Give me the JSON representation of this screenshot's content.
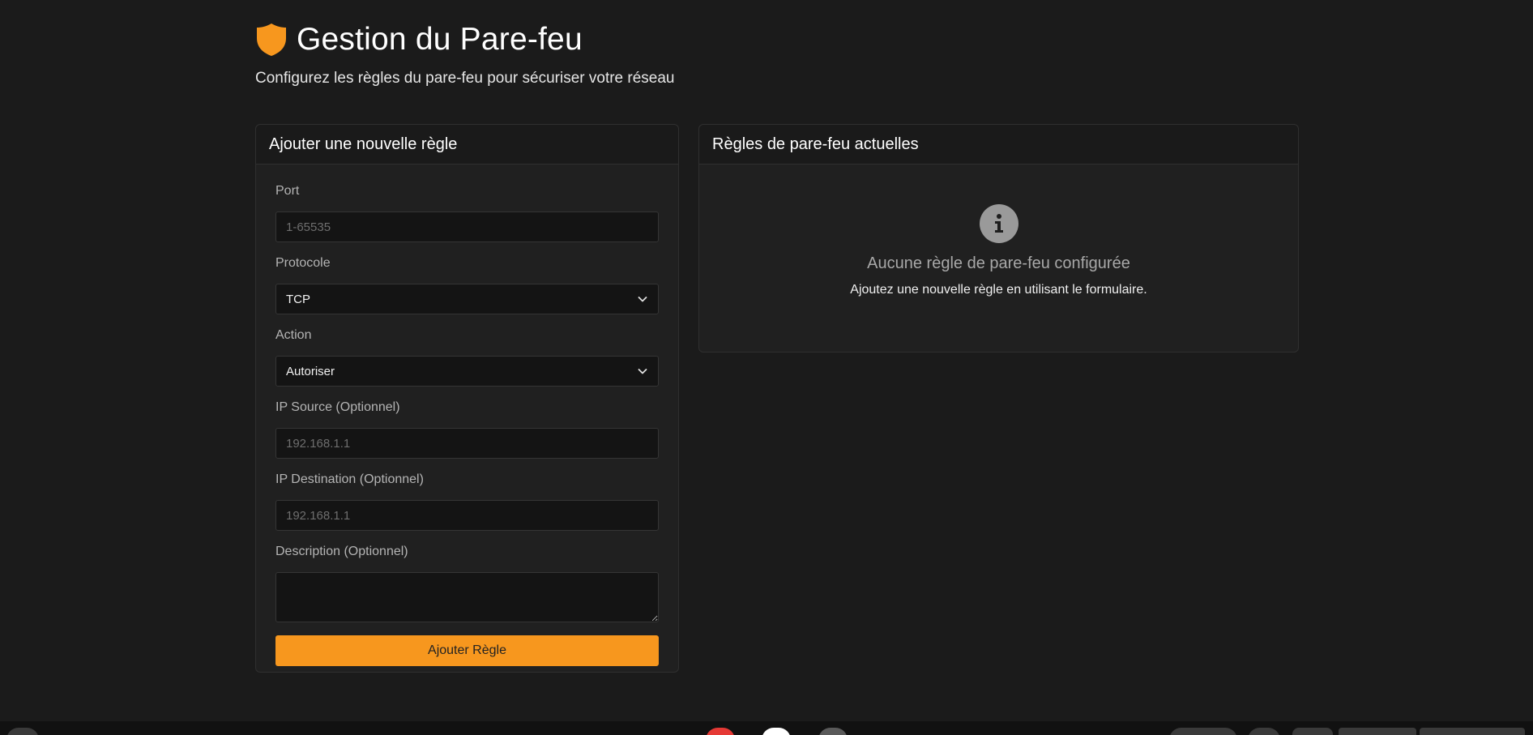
{
  "header": {
    "title": "Gestion du Pare-feu",
    "subtitle": "Configurez les règles du pare-feu pour sécuriser votre réseau"
  },
  "form": {
    "title": "Ajouter une nouvelle règle",
    "port": {
      "label": "Port",
      "value": "",
      "placeholder": "1-65535"
    },
    "protocol": {
      "label": "Protocole",
      "selected": "TCP"
    },
    "action": {
      "label": "Action",
      "selected": "Autoriser"
    },
    "source_ip": {
      "label": "IP Source (Optionnel)",
      "value": "",
      "placeholder": "192.168.1.1"
    },
    "destination_ip": {
      "label": "IP Destination (Optionnel)",
      "value": "",
      "placeholder": "192.168.1.1"
    },
    "description": {
      "label": "Description (Optionnel)",
      "value": ""
    },
    "submit_label": "Ajouter Règle"
  },
  "rules": {
    "title": "Règles de pare-feu actuelles",
    "empty_title": "Aucune règle de pare-feu configurée",
    "empty_text": "Ajoutez une nouvelle règle en utilisant le formulaire."
  },
  "colors": {
    "accent": "#f7971e",
    "background": "#1b1b1b",
    "card": "#202020",
    "input": "#141414"
  },
  "icons": {
    "title_icon": "shield-icon",
    "select_icon": "chevron-down-icon",
    "empty_icon": "info-icon"
  }
}
